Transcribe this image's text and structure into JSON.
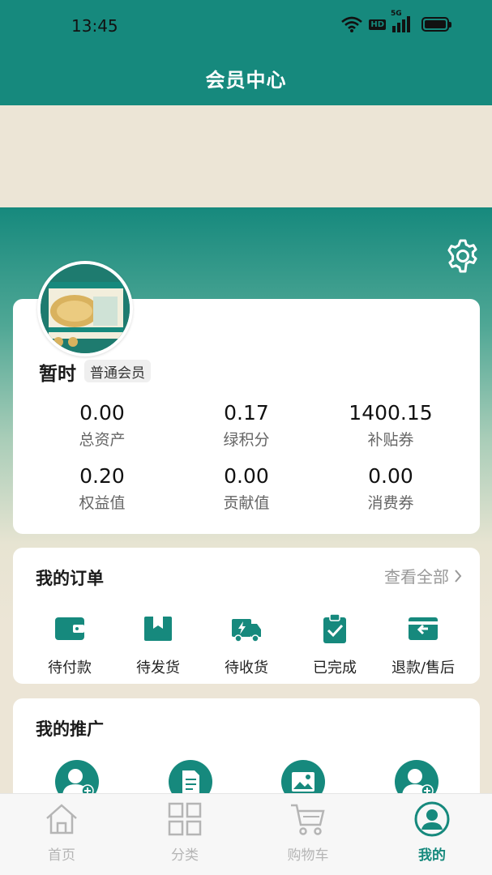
{
  "status_bar": {
    "time": "13:45",
    "network": "5G",
    "hd": "HD"
  },
  "header": {
    "title": "会员中心"
  },
  "profile": {
    "name": "暂时",
    "level": "普通会员",
    "stats": [
      {
        "value": "0.00",
        "label": "总资产"
      },
      {
        "value": "0.17",
        "label": "绿积分"
      },
      {
        "value": "1400.15",
        "label": "补贴券"
      },
      {
        "value": "0.20",
        "label": "权益值"
      },
      {
        "value": "0.00",
        "label": "贡献值"
      },
      {
        "value": "0.00",
        "label": "消费券"
      }
    ]
  },
  "orders": {
    "title": "我的订单",
    "view_all": "查看全部",
    "items": [
      {
        "label": "待付款",
        "icon": "wallet-icon"
      },
      {
        "label": "待发货",
        "icon": "package-icon"
      },
      {
        "label": "待收货",
        "icon": "delivery-truck-icon"
      },
      {
        "label": "已完成",
        "icon": "clipboard-check-icon"
      },
      {
        "label": "退款/售后",
        "icon": "refund-icon"
      }
    ]
  },
  "promotion": {
    "title": "我的推广",
    "items": [
      {
        "icon": "add-user-icon"
      },
      {
        "icon": "document-icon"
      },
      {
        "icon": "image-icon"
      },
      {
        "icon": "add-user-icon"
      }
    ]
  },
  "tabbar": {
    "items": [
      {
        "label": "首页",
        "icon": "home-icon",
        "active": false
      },
      {
        "label": "分类",
        "icon": "category-grid-icon",
        "active": false
      },
      {
        "label": "购物车",
        "icon": "cart-icon",
        "active": false
      },
      {
        "label": "我的",
        "icon": "user-profile-icon",
        "active": true
      }
    ]
  },
  "colors": {
    "accent": "#16897D",
    "background": "#ECE5D6",
    "inactive": "#B5B5B5"
  }
}
